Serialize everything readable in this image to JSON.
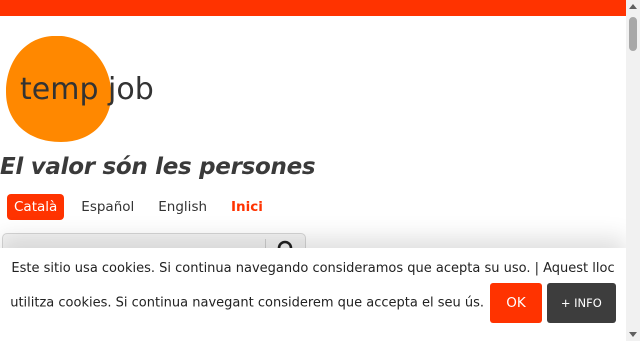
{
  "brand": {
    "logo_text_part1": "temp",
    "logo_text_part2": "job",
    "logo_color": "#ff8800",
    "accent_color": "#ff3300"
  },
  "tagline": "El valor són les persones",
  "languages": [
    {
      "label": "Català",
      "active": true
    },
    {
      "label": "Español",
      "active": false
    },
    {
      "label": "English",
      "active": false
    }
  ],
  "home_link": "Inici",
  "search": {
    "placeholder": "",
    "icon": "search-icon"
  },
  "cookie_banner": {
    "text": "Este sitio usa cookies. Si continua navegando consideramos que acepta su uso. | Aquest lloc utilitza cookies. Si continua navegant considerem que accepta el seu ús.",
    "ok_label": "OK",
    "info_label": "+ INFO"
  }
}
